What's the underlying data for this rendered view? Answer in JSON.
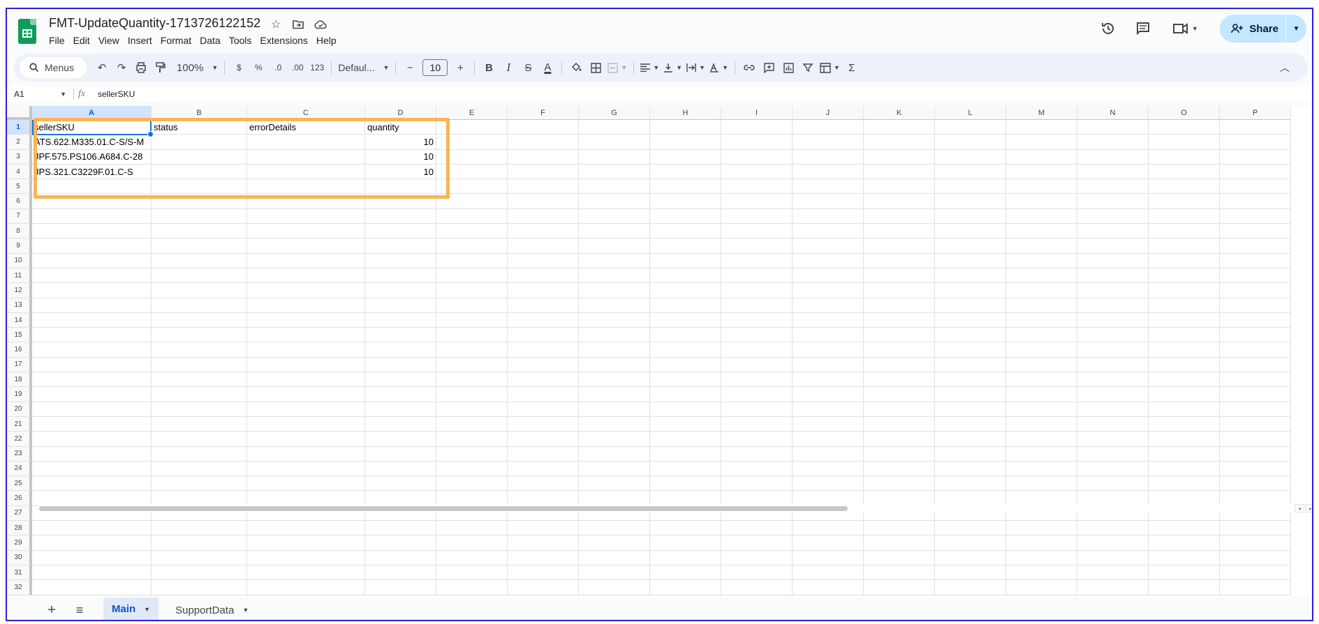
{
  "doc": {
    "title": "FMT-UpdateQuantity-1713726122152",
    "menu": [
      "File",
      "Edit",
      "View",
      "Insert",
      "Format",
      "Data",
      "Tools",
      "Extensions",
      "Help"
    ]
  },
  "header": {
    "share_label": "Share"
  },
  "toolbar": {
    "search_label": "Menus",
    "zoom": "100%",
    "currency": "$",
    "percent": "%",
    "dec_decrease": ".0",
    "dec_increase": ".00",
    "number_format": "123",
    "font": "Defaul...",
    "minus": "−",
    "font_size": "10",
    "plus": "+",
    "bold": "B",
    "italic": "I",
    "strike": "S",
    "text_color": "A",
    "sum": "Σ"
  },
  "formula_bar": {
    "cell_ref": "A1",
    "fx": "fx",
    "value": "sellerSKU"
  },
  "grid": {
    "columns": [
      "A",
      "B",
      "C",
      "D",
      "E",
      "F",
      "G",
      "H",
      "I",
      "J",
      "K",
      "L",
      "M",
      "N",
      "O",
      "P"
    ],
    "rows": [
      "1",
      "2",
      "3",
      "4",
      "5",
      "6",
      "7",
      "8",
      "9",
      "10",
      "11",
      "12",
      "13",
      "14",
      "15",
      "16",
      "17",
      "18",
      "19",
      "20",
      "21",
      "22",
      "23",
      "24",
      "25",
      "26",
      "27",
      "28",
      "29",
      "30",
      "31",
      "32"
    ],
    "data": [
      [
        "sellerSKU",
        "status",
        "errorDetails",
        "quantity"
      ],
      [
        "ATS.622.M335.01.C-S/S-M",
        "",
        "",
        "10"
      ],
      [
        "JPF.575.PS106.A684.C-28",
        "",
        "",
        "10"
      ],
      [
        "JPS.321.C3229F.01.C-S",
        "",
        "",
        "10"
      ]
    ]
  },
  "sheets": [
    {
      "name": "Main",
      "active": true
    },
    {
      "name": "SupportData",
      "active": false
    }
  ],
  "colors": {
    "accent": "#0b57d0",
    "highlight": "#fbb454",
    "frame": "#2b1fd6",
    "share_bg": "#c2e7ff"
  }
}
